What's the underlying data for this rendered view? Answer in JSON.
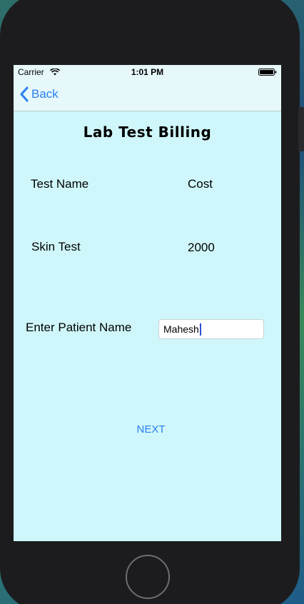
{
  "status_bar": {
    "carrier": "Carrier",
    "time": "1:01 PM"
  },
  "nav": {
    "back_label": "Back"
  },
  "page": {
    "title": "Lab Test Billing"
  },
  "table": {
    "headers": [
      "Test Name",
      "Cost"
    ],
    "rows": [
      {
        "test_name": "Skin Test",
        "cost": "2000"
      }
    ]
  },
  "patient": {
    "label": "Enter Patient Name",
    "value": "Mahesh"
  },
  "actions": {
    "next_label": "NEXT"
  },
  "colors": {
    "accent": "#2b7ff0",
    "screen_background": "#cff7fb",
    "nav_background": "#e6f8fa"
  }
}
